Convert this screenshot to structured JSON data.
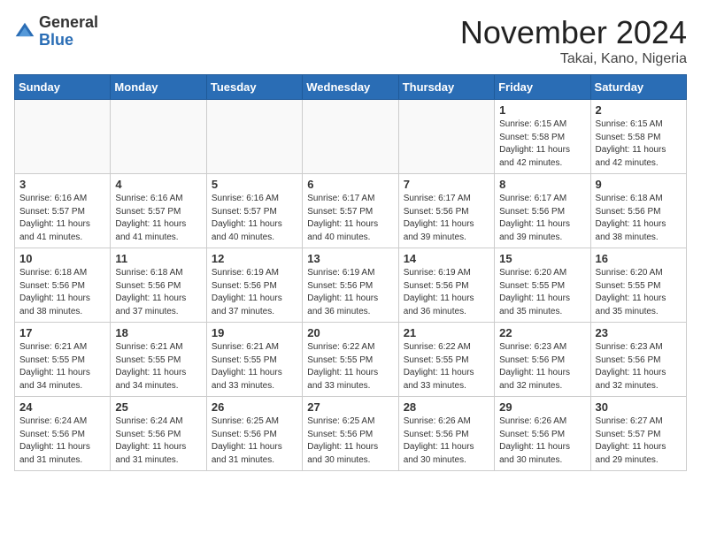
{
  "header": {
    "logo_general": "General",
    "logo_blue": "Blue",
    "month_title": "November 2024",
    "location": "Takai, Kano, Nigeria"
  },
  "days_of_week": [
    "Sunday",
    "Monday",
    "Tuesday",
    "Wednesday",
    "Thursday",
    "Friday",
    "Saturday"
  ],
  "weeks": [
    [
      {
        "day": "",
        "info": ""
      },
      {
        "day": "",
        "info": ""
      },
      {
        "day": "",
        "info": ""
      },
      {
        "day": "",
        "info": ""
      },
      {
        "day": "",
        "info": ""
      },
      {
        "day": "1",
        "info": "Sunrise: 6:15 AM\nSunset: 5:58 PM\nDaylight: 11 hours\nand 42 minutes."
      },
      {
        "day": "2",
        "info": "Sunrise: 6:15 AM\nSunset: 5:58 PM\nDaylight: 11 hours\nand 42 minutes."
      }
    ],
    [
      {
        "day": "3",
        "info": "Sunrise: 6:16 AM\nSunset: 5:57 PM\nDaylight: 11 hours\nand 41 minutes."
      },
      {
        "day": "4",
        "info": "Sunrise: 6:16 AM\nSunset: 5:57 PM\nDaylight: 11 hours\nand 41 minutes."
      },
      {
        "day": "5",
        "info": "Sunrise: 6:16 AM\nSunset: 5:57 PM\nDaylight: 11 hours\nand 40 minutes."
      },
      {
        "day": "6",
        "info": "Sunrise: 6:17 AM\nSunset: 5:57 PM\nDaylight: 11 hours\nand 40 minutes."
      },
      {
        "day": "7",
        "info": "Sunrise: 6:17 AM\nSunset: 5:56 PM\nDaylight: 11 hours\nand 39 minutes."
      },
      {
        "day": "8",
        "info": "Sunrise: 6:17 AM\nSunset: 5:56 PM\nDaylight: 11 hours\nand 39 minutes."
      },
      {
        "day": "9",
        "info": "Sunrise: 6:18 AM\nSunset: 5:56 PM\nDaylight: 11 hours\nand 38 minutes."
      }
    ],
    [
      {
        "day": "10",
        "info": "Sunrise: 6:18 AM\nSunset: 5:56 PM\nDaylight: 11 hours\nand 38 minutes."
      },
      {
        "day": "11",
        "info": "Sunrise: 6:18 AM\nSunset: 5:56 PM\nDaylight: 11 hours\nand 37 minutes."
      },
      {
        "day": "12",
        "info": "Sunrise: 6:19 AM\nSunset: 5:56 PM\nDaylight: 11 hours\nand 37 minutes."
      },
      {
        "day": "13",
        "info": "Sunrise: 6:19 AM\nSunset: 5:56 PM\nDaylight: 11 hours\nand 36 minutes."
      },
      {
        "day": "14",
        "info": "Sunrise: 6:19 AM\nSunset: 5:56 PM\nDaylight: 11 hours\nand 36 minutes."
      },
      {
        "day": "15",
        "info": "Sunrise: 6:20 AM\nSunset: 5:55 PM\nDaylight: 11 hours\nand 35 minutes."
      },
      {
        "day": "16",
        "info": "Sunrise: 6:20 AM\nSunset: 5:55 PM\nDaylight: 11 hours\nand 35 minutes."
      }
    ],
    [
      {
        "day": "17",
        "info": "Sunrise: 6:21 AM\nSunset: 5:55 PM\nDaylight: 11 hours\nand 34 minutes."
      },
      {
        "day": "18",
        "info": "Sunrise: 6:21 AM\nSunset: 5:55 PM\nDaylight: 11 hours\nand 34 minutes."
      },
      {
        "day": "19",
        "info": "Sunrise: 6:21 AM\nSunset: 5:55 PM\nDaylight: 11 hours\nand 33 minutes."
      },
      {
        "day": "20",
        "info": "Sunrise: 6:22 AM\nSunset: 5:55 PM\nDaylight: 11 hours\nand 33 minutes."
      },
      {
        "day": "21",
        "info": "Sunrise: 6:22 AM\nSunset: 5:55 PM\nDaylight: 11 hours\nand 33 minutes."
      },
      {
        "day": "22",
        "info": "Sunrise: 6:23 AM\nSunset: 5:56 PM\nDaylight: 11 hours\nand 32 minutes."
      },
      {
        "day": "23",
        "info": "Sunrise: 6:23 AM\nSunset: 5:56 PM\nDaylight: 11 hours\nand 32 minutes."
      }
    ],
    [
      {
        "day": "24",
        "info": "Sunrise: 6:24 AM\nSunset: 5:56 PM\nDaylight: 11 hours\nand 31 minutes."
      },
      {
        "day": "25",
        "info": "Sunrise: 6:24 AM\nSunset: 5:56 PM\nDaylight: 11 hours\nand 31 minutes."
      },
      {
        "day": "26",
        "info": "Sunrise: 6:25 AM\nSunset: 5:56 PM\nDaylight: 11 hours\nand 31 minutes."
      },
      {
        "day": "27",
        "info": "Sunrise: 6:25 AM\nSunset: 5:56 PM\nDaylight: 11 hours\nand 30 minutes."
      },
      {
        "day": "28",
        "info": "Sunrise: 6:26 AM\nSunset: 5:56 PM\nDaylight: 11 hours\nand 30 minutes."
      },
      {
        "day": "29",
        "info": "Sunrise: 6:26 AM\nSunset: 5:56 PM\nDaylight: 11 hours\nand 30 minutes."
      },
      {
        "day": "30",
        "info": "Sunrise: 6:27 AM\nSunset: 5:57 PM\nDaylight: 11 hours\nand 29 minutes."
      }
    ]
  ]
}
